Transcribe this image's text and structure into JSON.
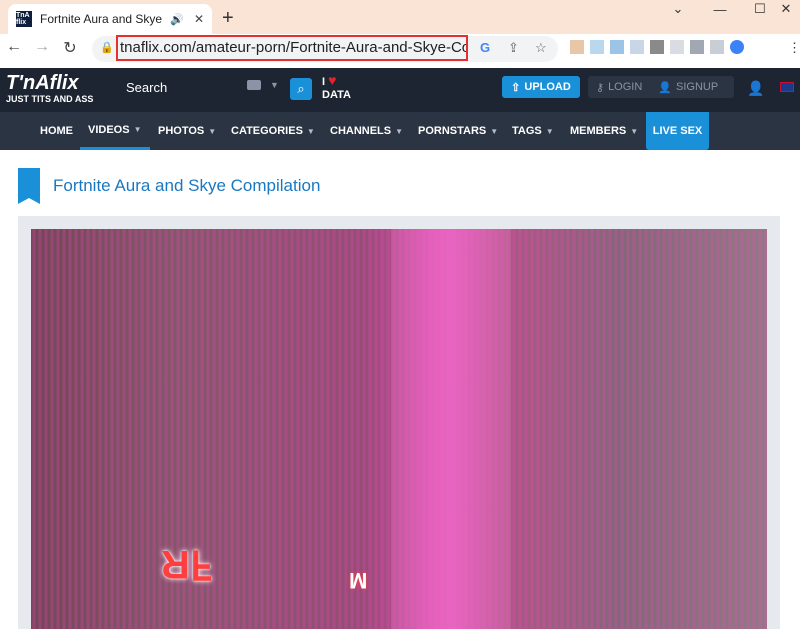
{
  "browser": {
    "tab_title": "Fortnite Aura and Skye Co",
    "favicon_text": "TnA flix",
    "new_tab_label": "+",
    "url": "tnaflix.com/amateur-porn/Fortnite-Aura-and-Skye-Compil..."
  },
  "site": {
    "logo": "T'nAflix",
    "tagline": "JUST TITS AND ASS",
    "search_label": "Search",
    "ilove_top": "I",
    "ilove_bottom": "DATA",
    "upload_label": "UPLOAD",
    "login_label": "LOGIN",
    "signup_label": "SIGNUP"
  },
  "nav": {
    "items": [
      "HOME",
      "VIDEOS",
      "PHOTOS",
      "CATEGORIES",
      "CHANNELS",
      "PORNSTARS",
      "TAGS",
      "MEMBERS"
    ],
    "live_label": "LIVE SEX",
    "active": "VIDEOS"
  },
  "video": {
    "title": "Fortnite Aura and Skye Compilation"
  },
  "colors": {
    "accent": "#1a90d9",
    "header_bg": "#1d2532",
    "nav_bg": "#2b3442",
    "highlight_red": "#e53030"
  }
}
